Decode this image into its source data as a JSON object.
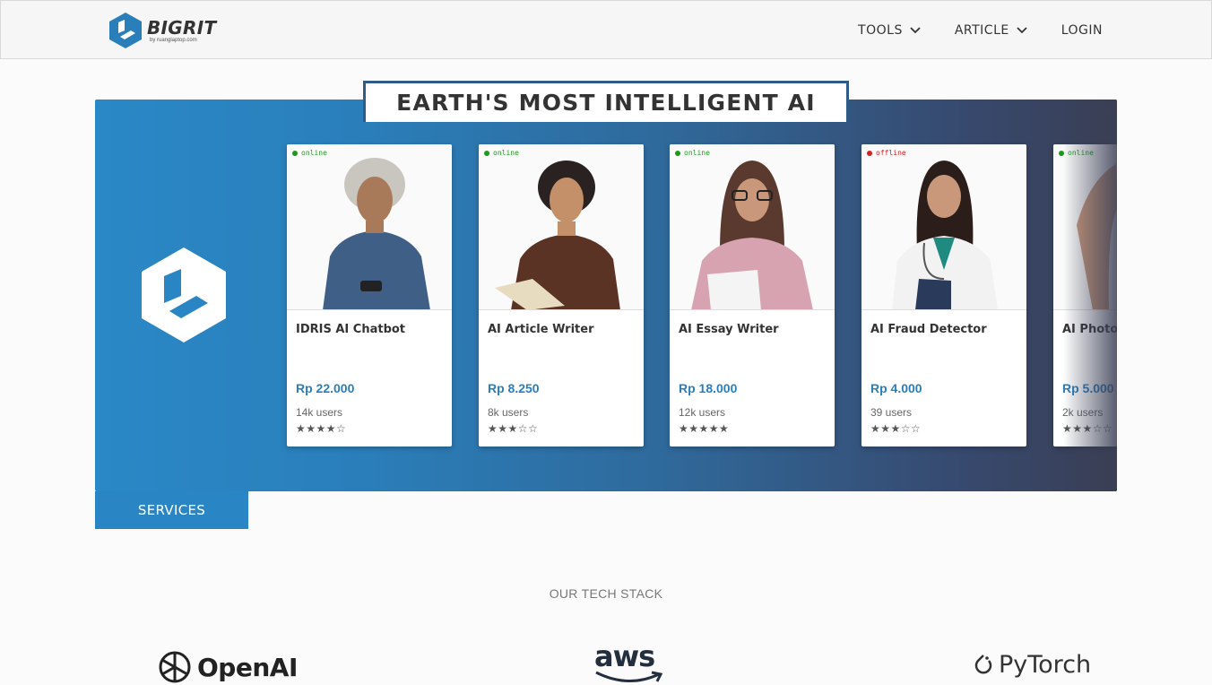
{
  "brand": {
    "name": "BIGRIT",
    "sub": "by ruanglaptop.com",
    "color": "#2a7fbb"
  },
  "nav": {
    "tools_label": "TOOLS",
    "article_label": "ARTICLE",
    "login_label": "LOGIN"
  },
  "hero": {
    "title": "EARTH'S MOST INTELLIGENT AI",
    "services_label": "SERVICES"
  },
  "cards": [
    {
      "status": "online",
      "status_color": "#1a9a1a",
      "name": "IDRIS AI Chatbot",
      "price": "Rp 22.000",
      "users": "14k users",
      "stars": "★★★★☆",
      "rating": 4
    },
    {
      "status": "online",
      "status_color": "#1a9a1a",
      "name": "AI Article Writer",
      "price": "Rp 8.250",
      "users": "8k users",
      "stars": "★★★☆☆",
      "rating": 3
    },
    {
      "status": "online",
      "status_color": "#1a9a1a",
      "name": "AI Essay Writer",
      "price": "Rp 18.000",
      "users": "12k users",
      "stars": "★★★★★",
      "rating": 5
    },
    {
      "status": "offline",
      "status_color": "#d42020",
      "name": "AI Fraud Detector",
      "price": "Rp 4.000",
      "users": "39 users",
      "stars": "★★★☆☆",
      "rating": 3
    },
    {
      "status": "online",
      "status_color": "#1a9a1a",
      "name": "AI Photo",
      "price": "Rp 5.000",
      "users": "2k users",
      "stars": "★★★☆☆",
      "rating": 3
    }
  ],
  "tech": {
    "title": "OUR TECH STACK",
    "openai": "OpenAI",
    "aws": "aws",
    "pytorch": "PyTorch"
  }
}
